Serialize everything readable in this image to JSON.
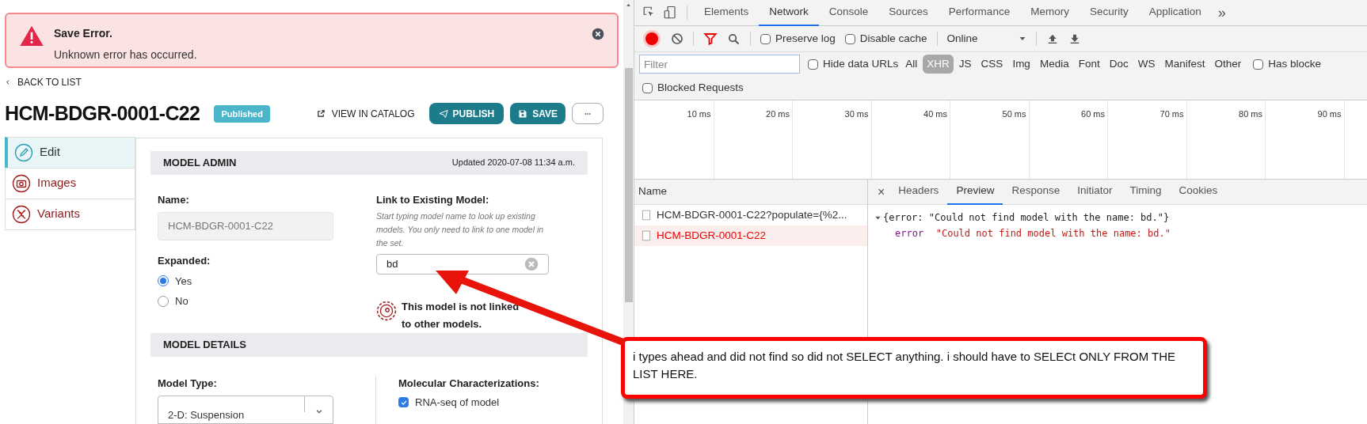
{
  "alert": {
    "title": "Save Error.",
    "message": "Unknown error has occurred."
  },
  "back_link": "BACK TO LIST",
  "title": "HCM-BDGR-0001-C22",
  "status_badge": "Published",
  "actions": {
    "view": "VIEW IN CATALOG",
    "publish": "PUBLISH",
    "save": "SAVE"
  },
  "side_tabs": [
    {
      "label": "Edit",
      "selected": true
    },
    {
      "label": "Images",
      "selected": false
    },
    {
      "label": "Variants",
      "selected": false
    }
  ],
  "model_admin": {
    "heading": "MODEL ADMIN",
    "updated": "Updated 2020-07-08 11:34 a.m.",
    "name_label": "Name:",
    "name_value": "HCM-BDGR-0001-C22",
    "expanded_label": "Expanded:",
    "options": [
      {
        "label": "Yes",
        "selected": true
      },
      {
        "label": "No",
        "selected": false
      }
    ],
    "link_label": "Link to Existing Model:",
    "link_hint": "Start typing model name to look up existing models. You only need to link to one model in the set.",
    "link_value": "bd",
    "link_status": "This model is not linked to other models."
  },
  "model_details": {
    "heading": "MODEL DETAILS",
    "model_type_label": "Model Type:",
    "model_type_value": "2-D: Suspension",
    "molecular_label": "Molecular Characterizations:",
    "checks": [
      {
        "label": "RNA-seq of model",
        "checked": true
      }
    ]
  },
  "devtools": {
    "tabs": [
      {
        "label": "Elements",
        "selected": false
      },
      {
        "label": "Network",
        "selected": true
      },
      {
        "label": "Console",
        "selected": false
      },
      {
        "label": "Sources",
        "selected": false
      },
      {
        "label": "Performance",
        "selected": false
      },
      {
        "label": "Memory",
        "selected": false
      },
      {
        "label": "Security",
        "selected": false
      },
      {
        "label": "Application",
        "selected": false
      }
    ],
    "more": "»",
    "preserve_log": {
      "label": "Preserve log",
      "checked": false
    },
    "disable_cache": {
      "label": "Disable cache",
      "checked": false
    },
    "throttle": "Online",
    "filter_placeholder": "Filter",
    "hide_data_urls": {
      "label": "Hide data URLs",
      "checked": false
    },
    "types": [
      {
        "label": "All",
        "selected": false
      },
      {
        "label": "XHR",
        "selected": true
      },
      {
        "label": "JS",
        "selected": false
      },
      {
        "label": "CSS",
        "selected": false
      },
      {
        "label": "Img",
        "selected": false
      },
      {
        "label": "Media",
        "selected": false
      },
      {
        "label": "Font",
        "selected": false
      },
      {
        "label": "Doc",
        "selected": false
      },
      {
        "label": "WS",
        "selected": false
      },
      {
        "label": "Manifest",
        "selected": false
      },
      {
        "label": "Other",
        "selected": false
      }
    ],
    "has_blocked": {
      "label": "Has blocke",
      "checked": false
    },
    "blocked_requests": {
      "label": "Blocked Requests",
      "checked": false
    },
    "ticks": [
      "10 ms",
      "20 ms",
      "30 ms",
      "40 ms",
      "50 ms",
      "60 ms",
      "70 ms",
      "80 ms",
      "90 ms"
    ],
    "name_header": "Name",
    "requests": [
      {
        "name": "HCM-BDGR-0001-C22?populate={%2...",
        "failed": false
      },
      {
        "name": "HCM-BDGR-0001-C22",
        "failed": true
      }
    ],
    "close": "×",
    "detail_tabs": [
      {
        "label": "Headers",
        "selected": false
      },
      {
        "label": "Preview",
        "selected": true
      },
      {
        "label": "Response",
        "selected": false
      },
      {
        "label": "Initiator",
        "selected": false
      },
      {
        "label": "Timing",
        "selected": false
      },
      {
        "label": "Cookies",
        "selected": false
      }
    ],
    "preview_summary": "{error: \"Could not find model with the name: bd.\"}",
    "preview_key": "error",
    "preview_value": "\"Could not find model with the name: bd.\""
  },
  "callout": "i types ahead and did not find so did not SELECT anything.  i should have to SELECt ONLY FROM THE LIST HERE."
}
